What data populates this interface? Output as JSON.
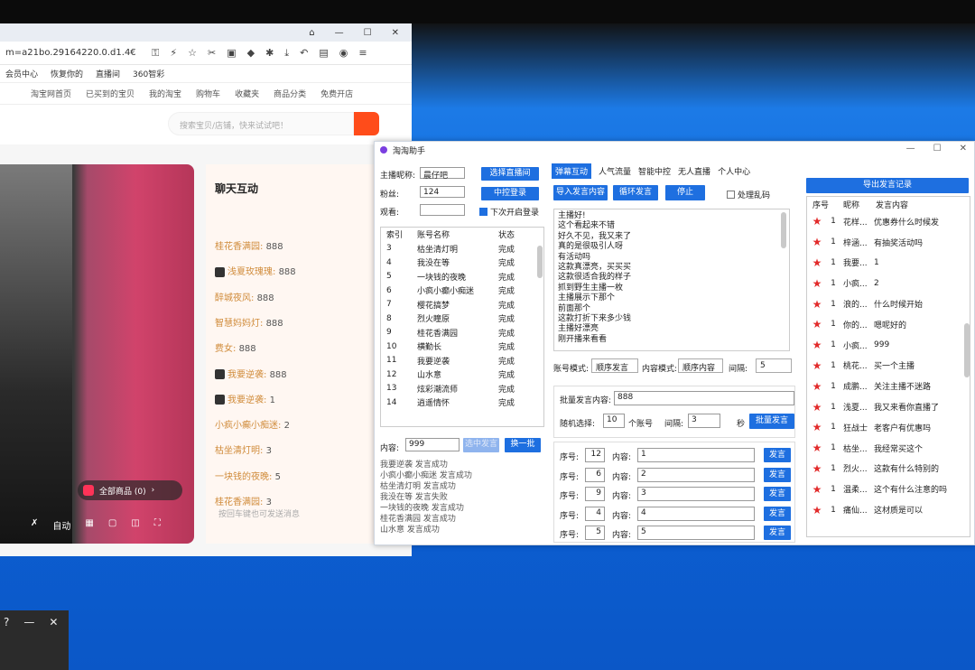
{
  "browser": {
    "url": "m=a21bo.29164220.0.d1.4€",
    "bookmarks": [
      "会员中心",
      "恢复你的",
      "直播间",
      "360智彩"
    ],
    "nav": [
      "淘宝网首页",
      "已买到的宝贝",
      "我的淘宝",
      "购物车",
      "收藏夹",
      "商品分类",
      "免费开店"
    ],
    "search_placeholder": "搜索宝贝/店铺，快来试试吧！",
    "all_goods": "全部商品 (0)",
    "auto_label": "自动",
    "chat": {
      "title": "聊天互动",
      "messages": [
        {
          "name": "桂花香满园:",
          "value": "888",
          "badge": false
        },
        {
          "name": "浅夏玫瑰瑰:",
          "value": "888",
          "badge": true
        },
        {
          "name": "醉城夜风:",
          "value": "888",
          "badge": false
        },
        {
          "name": "智慧妈妈灯:",
          "value": "888",
          "badge": false
        },
        {
          "name": "费女:",
          "value": "888",
          "badge": false
        },
        {
          "name": "我要逆袭:",
          "value": "888",
          "badge": true
        },
        {
          "name": "我要逆袭:",
          "value": "1",
          "badge": true
        },
        {
          "name": "小疯小癫小痴迷:",
          "value": "2",
          "badge": false
        },
        {
          "name": "枯坐清灯明:",
          "value": "3",
          "badge": false
        },
        {
          "name": "一块钱的夜晚:",
          "value": "5",
          "badge": false
        },
        {
          "name": "桂花香满园:",
          "value": "3",
          "badge": false
        }
      ],
      "input_placeholder": "按回车键也可发送消息"
    }
  },
  "app": {
    "title": "淘淘助手",
    "tabs": [
      "弹幕互动",
      "人气流量",
      "智能中控",
      "无人直播",
      "个人中心"
    ],
    "left": {
      "anchor_label": "主播昵称:",
      "anchor_value": "晨仔吧",
      "choose_live": "选择直播间",
      "fans_label": "粉丝:",
      "fans_value": "124",
      "central_login": "中控登录",
      "viewers_label": "观看:",
      "auto_login": "下次开启登录",
      "accounts": {
        "columns": [
          "索引",
          "账号名称",
          "状态"
        ],
        "rows": [
          [
            "3",
            "枯坐清灯明",
            "完成"
          ],
          [
            "4",
            "我没在等",
            "完成"
          ],
          [
            "5",
            "一块钱的夜晚",
            "完成"
          ],
          [
            "6",
            "小疯小癫小痴迷",
            "完成"
          ],
          [
            "7",
            "樱花搞梦",
            "完成"
          ],
          [
            "8",
            "烈火瞳原",
            "完成"
          ],
          [
            "9",
            "桂花香满园",
            "完成"
          ],
          [
            "10",
            "横勤长",
            "完成"
          ],
          [
            "11",
            "我要逆袭",
            "完成"
          ],
          [
            "12",
            "山水意",
            "完成"
          ],
          [
            "13",
            "炫彩潮流师",
            "完成"
          ],
          [
            "14",
            "逍遥情怀",
            "完成"
          ]
        ]
      },
      "content_label": "内容:",
      "content_value": "999",
      "send_selected": "选中发言",
      "switch_batch": "换一批",
      "log": [
        "我要逆袭  发言成功",
        "小疯小癫小痴迷  发言成功",
        "枯坐清灯明  发言成功",
        "我没在等  发言失败",
        "一块钱的夜晚  发言成功",
        "桂花香满园  发言成功",
        "山水意  发言成功"
      ]
    },
    "mid": {
      "import_btn": "导入发言内容",
      "loop_btn": "循环发言",
      "stop_btn": "停止",
      "shuffle_label": "处理乱码",
      "phrases": [
        "主播好!",
        "这个看起来不错",
        "好久不见，我又来了",
        "真的是很吸引人呀",
        "有活动吗",
        "这款真漂亮，买买买",
        "这款很适合我的样子",
        "抓到野生主播一枚",
        "主播展示下那个",
        "前面那个",
        "这款打折下来多少钱",
        "主播好漂亮",
        "刚开播来看看"
      ],
      "account_mode_label": "账号模式:",
      "account_mode_value": "顺序发言",
      "content_mode_label": "内容模式:",
      "content_mode_value": "顺序内容",
      "interval_label": "间隔:",
      "interval_value": "5",
      "batch_label": "批量发言内容:",
      "batch_value": "888",
      "random_label": "随机选择:",
      "random_value": "10",
      "accounts_suffix": "个账号",
      "batch_interval_value": "3",
      "seconds_suffix": "秒",
      "batch_send": "批量发言",
      "seq_label": "序号:",
      "content_label": "内容:",
      "send_label": "发言",
      "send_rows": [
        {
          "seq": "12",
          "content": "1"
        },
        {
          "seq": "6",
          "content": "2"
        },
        {
          "seq": "9",
          "content": "3"
        },
        {
          "seq": "4",
          "content": "4"
        },
        {
          "seq": "5",
          "content": "5"
        }
      ]
    },
    "right": {
      "export_btn": "导出发言记录",
      "columns": [
        "序号",
        "昵称",
        "发言内容"
      ],
      "rows": [
        {
          "n": "1",
          "name": "花样...",
          "content": "优惠券什么时候发"
        },
        {
          "n": "1",
          "name": "梓涵...",
          "content": "有抽奖活动吗"
        },
        {
          "n": "1",
          "name": "我要...",
          "content": "1"
        },
        {
          "n": "1",
          "name": "小疯...",
          "content": "2"
        },
        {
          "n": "1",
          "name": "浪的...",
          "content": "什么时候开始"
        },
        {
          "n": "1",
          "name": "你的...",
          "content": "嗯呢好的"
        },
        {
          "n": "1",
          "name": "小疯...",
          "content": "999"
        },
        {
          "n": "1",
          "name": "桃花...",
          "content": "买一个主播"
        },
        {
          "n": "1",
          "name": "成鹏...",
          "content": "关注主播不迷路"
        },
        {
          "n": "1",
          "name": "浅夏...",
          "content": "我又来看你直播了"
        },
        {
          "n": "1",
          "name": "狂战士",
          "content": "老客户有优惠吗"
        },
        {
          "n": "1",
          "name": "枯坐...",
          "content": "我经常买这个"
        },
        {
          "n": "1",
          "name": "烈火...",
          "content": "这款有什么特别的"
        },
        {
          "n": "1",
          "name": "温柔...",
          "content": "这个有什么注意的吗"
        },
        {
          "n": "1",
          "name": "痛仙...",
          "content": "这材质是可以"
        }
      ]
    }
  }
}
